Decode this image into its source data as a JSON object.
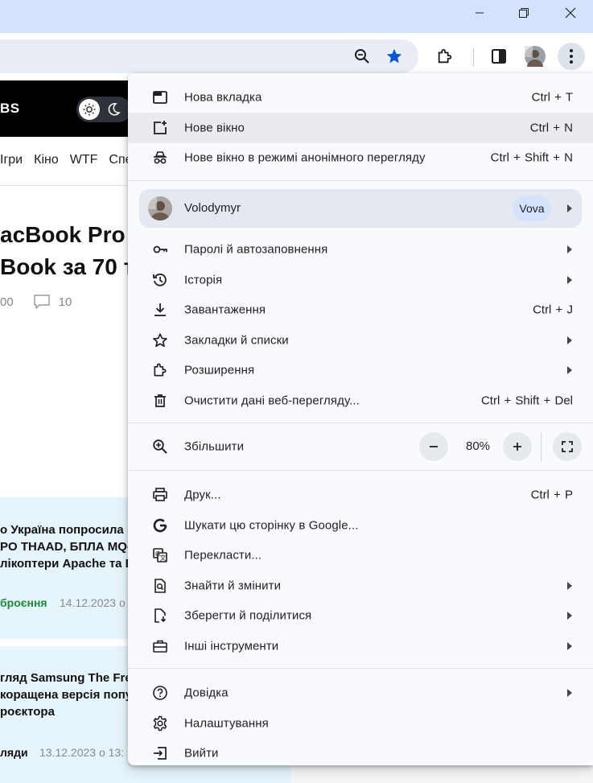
{
  "window": {
    "controls": [
      "minimize-icon",
      "restore-icon",
      "close-icon"
    ]
  },
  "toolbar": {
    "icons": [
      "zoom-icon",
      "bookmark-star-icon",
      "extensions-icon",
      "side-panel-icon",
      "profile-avatar",
      "kebab-menu-icon"
    ],
    "accent": "#0b57d0"
  },
  "page": {
    "logo": "BS",
    "nav": [
      "Ігри",
      "Кіно",
      "WTF",
      "Спе"
    ],
    "article": {
      "title_line1": "acBook Pro",
      "title_line2": "Book за 70 т",
      "views": "00",
      "comments": "10"
    },
    "cards": [
      {
        "text": "о Україна попросила\nPO THAAD, БПЛА MQ-\nлікоптери Apache та E",
        "category": "броєння",
        "category_color": "#1a8a3a",
        "date": "14.12.2023 о"
      },
      {
        "text": "гляд Samsung The Fre\nкоращена версія попу\nроєктора",
        "category": "ляди",
        "category_color": "#111111",
        "date": "13.12.2023 о 13:"
      }
    ]
  },
  "menu": {
    "items": [
      {
        "id": "new-tab",
        "icon": "new-tab-icon",
        "label": "Нова вкладка",
        "shortcut": "Ctrl + T",
        "arrow": false
      },
      {
        "id": "new-window",
        "icon": "new-window-icon",
        "label": "Нове вікно",
        "shortcut": "Ctrl + N",
        "arrow": false
      },
      {
        "id": "incognito",
        "icon": "incognito-icon",
        "label": "Нове вікно в режимі анонімного перегляду",
        "shortcut": "Ctrl + Shift + N",
        "arrow": false
      },
      {
        "id": "passwords",
        "icon": "key-icon",
        "label": "Паролі й автозаповнення",
        "shortcut": "",
        "arrow": true
      },
      {
        "id": "history",
        "icon": "history-icon",
        "label": "Історія",
        "shortcut": "",
        "arrow": true
      },
      {
        "id": "downloads",
        "icon": "download-icon",
        "label": "Завантаження",
        "shortcut": "Ctrl + J",
        "arrow": false
      },
      {
        "id": "bookmarks",
        "icon": "star-icon",
        "label": "Закладки й списки",
        "shortcut": "",
        "arrow": true
      },
      {
        "id": "extensions",
        "icon": "puzzle-icon",
        "label": "Розширення",
        "shortcut": "",
        "arrow": true
      },
      {
        "id": "clear-data",
        "icon": "trash-icon",
        "label": "Очистити дані веб-перегляду...",
        "shortcut": "Ctrl + Shift + Del",
        "arrow": false
      },
      {
        "id": "print",
        "icon": "printer-icon",
        "label": "Друк...",
        "shortcut": "Ctrl + P",
        "arrow": false
      },
      {
        "id": "search-google",
        "icon": "google-icon",
        "label": "Шукати цю сторінку в Google...",
        "shortcut": "",
        "arrow": false
      },
      {
        "id": "translate",
        "icon": "translate-icon",
        "label": "Перекласти...",
        "shortcut": "",
        "arrow": false
      },
      {
        "id": "find",
        "icon": "find-icon",
        "label": "Знайти й змінити",
        "shortcut": "",
        "arrow": true
      },
      {
        "id": "save-share",
        "icon": "save-share-icon",
        "label": "Зберегти й поділитися",
        "shortcut": "",
        "arrow": true
      },
      {
        "id": "more-tools",
        "icon": "toolbox-icon",
        "label": "Інші інструменти",
        "shortcut": "",
        "arrow": true
      },
      {
        "id": "help",
        "icon": "help-icon",
        "label": "Довідка",
        "shortcut": "",
        "arrow": true
      },
      {
        "id": "settings",
        "icon": "gear-icon",
        "label": "Налаштування",
        "shortcut": "",
        "arrow": false
      },
      {
        "id": "exit",
        "icon": "exit-icon",
        "label": "Вийти",
        "shortcut": "",
        "arrow": false
      }
    ],
    "highlighted": "new-window",
    "profile": {
      "name": "Volodymyr",
      "badge": "Vova"
    },
    "zoom": {
      "label": "Збільшити",
      "value": "80%",
      "minus": "−",
      "plus": "+"
    }
  }
}
